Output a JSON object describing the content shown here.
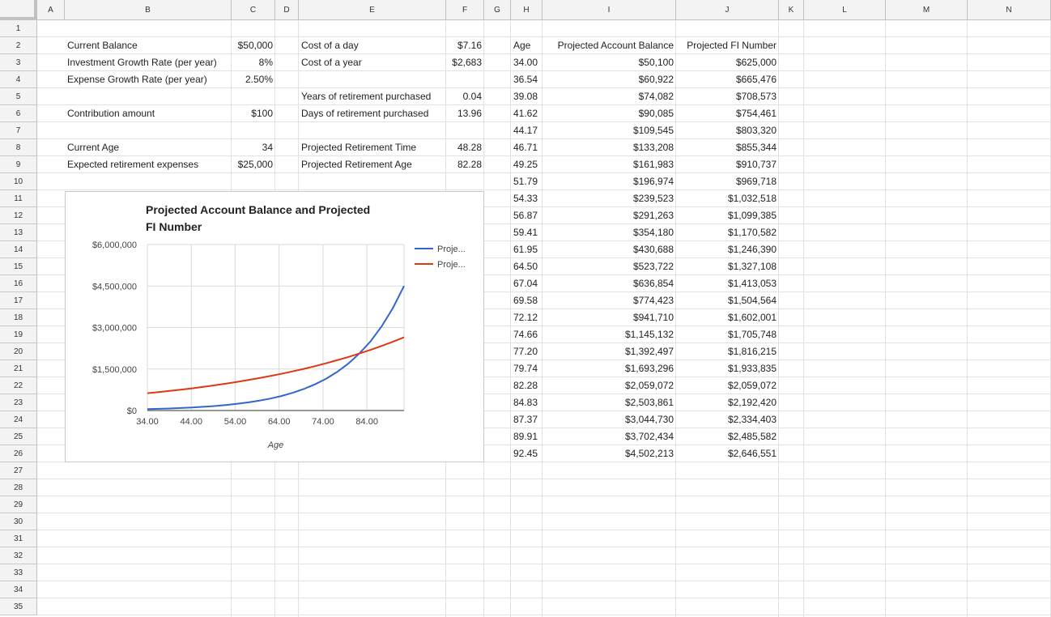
{
  "columns": [
    "A",
    "B",
    "C",
    "D",
    "E",
    "F",
    "G",
    "H",
    "I",
    "J",
    "K",
    "L",
    "M",
    "N"
  ],
  "rows": [
    "1",
    "2",
    "3",
    "4",
    "5",
    "6",
    "7",
    "8",
    "9",
    "10",
    "11",
    "12",
    "13",
    "14",
    "15",
    "16",
    "17",
    "18",
    "19",
    "20",
    "21",
    "22",
    "23",
    "24",
    "25",
    "26",
    "27",
    "28",
    "29",
    "30",
    "31",
    "32",
    "33",
    "34",
    "35"
  ],
  "inputs": [
    {
      "row": 2,
      "label": "Current Balance",
      "value": "$50,000"
    },
    {
      "row": 3,
      "label": "Investment Growth Rate (per year)",
      "value": "8%"
    },
    {
      "row": 4,
      "label": "Expense Growth Rate (per year)",
      "value": "2.50%"
    },
    {
      "row": 6,
      "label": "Contribution amount",
      "value": "$100"
    },
    {
      "row": 8,
      "label": "Current Age",
      "value": "34"
    },
    {
      "row": 9,
      "label": "Expected retirement expenses",
      "value": "$25,000"
    }
  ],
  "calcs": [
    {
      "row": 2,
      "label": "Cost of a day",
      "value": "$7.16"
    },
    {
      "row": 3,
      "label": "Cost of a year",
      "value": "$2,683"
    },
    {
      "row": 5,
      "label": "Years of retirement purchased",
      "value": "0.04"
    },
    {
      "row": 6,
      "label": "Days of retirement purchased",
      "value": "13.96"
    },
    {
      "row": 8,
      "label": "Projected Retirement Time",
      "value": "48.28"
    },
    {
      "row": 9,
      "label": "Projected Retirement Age",
      "value": "82.28"
    }
  ],
  "table": {
    "headers": [
      "Age",
      "Projected Account Balance",
      "Projected FI Number"
    ],
    "rows": [
      [
        "34.00",
        "$50,100",
        "$625,000"
      ],
      [
        "36.54",
        "$60,922",
        "$665,476"
      ],
      [
        "39.08",
        "$74,082",
        "$708,573"
      ],
      [
        "41.62",
        "$90,085",
        "$754,461"
      ],
      [
        "44.17",
        "$109,545",
        "$803,320"
      ],
      [
        "46.71",
        "$133,208",
        "$855,344"
      ],
      [
        "49.25",
        "$161,983",
        "$910,737"
      ],
      [
        "51.79",
        "$196,974",
        "$969,718"
      ],
      [
        "54.33",
        "$239,523",
        "$1,032,518"
      ],
      [
        "56.87",
        "$291,263",
        "$1,099,385"
      ],
      [
        "59.41",
        "$354,180",
        "$1,170,582"
      ],
      [
        "61.95",
        "$430,688",
        "$1,246,390"
      ],
      [
        "64.50",
        "$523,722",
        "$1,327,108"
      ],
      [
        "67.04",
        "$636,854",
        "$1,413,053"
      ],
      [
        "69.58",
        "$774,423",
        "$1,504,564"
      ],
      [
        "72.12",
        "$941,710",
        "$1,602,001"
      ],
      [
        "74.66",
        "$1,145,132",
        "$1,705,748"
      ],
      [
        "77.20",
        "$1,392,497",
        "$1,816,215"
      ],
      [
        "79.74",
        "$1,693,296",
        "$1,933,835"
      ],
      [
        "82.28",
        "$2,059,072",
        "$2,059,072"
      ],
      [
        "84.83",
        "$2,503,861",
        "$2,192,420"
      ],
      [
        "87.37",
        "$3,044,730",
        "$2,334,403"
      ],
      [
        "89.91",
        "$3,702,434",
        "$2,485,582"
      ],
      [
        "92.45",
        "$4,502,213",
        "$2,646,551"
      ]
    ]
  },
  "chart_data": {
    "type": "line",
    "title": "Projected Account Balance and Projected FI Number",
    "title_lines": [
      "Projected Account Balance and Projected",
      "FI Number"
    ],
    "xlabel": "Age",
    "ylabel": "",
    "x": [
      34.0,
      36.54,
      39.08,
      41.62,
      44.17,
      46.71,
      49.25,
      51.79,
      54.33,
      56.87,
      59.41,
      61.95,
      64.5,
      67.04,
      69.58,
      72.12,
      74.66,
      77.2,
      79.74,
      82.28,
      84.83,
      87.37,
      89.91,
      92.45
    ],
    "xlim": [
      34,
      92.45
    ],
    "xticks": [
      34,
      44,
      54,
      64,
      74,
      84
    ],
    "xtick_labels": [
      "34.00",
      "44.00",
      "54.00",
      "64.00",
      "74.00",
      "84.00"
    ],
    "ylim": [
      0,
      6000000
    ],
    "yticks": [
      0,
      1500000,
      3000000,
      4500000,
      6000000
    ],
    "ytick_labels": [
      "$0",
      "$1,500,000",
      "$3,000,000",
      "$4,500,000",
      "$6,000,000"
    ],
    "grid": true,
    "legend_position": "right",
    "legend_labels": [
      "Proje...",
      "Proje..."
    ],
    "series": [
      {
        "color": "#3366cc",
        "values": [
          50100,
          60922,
          74082,
          90085,
          109545,
          133208,
          161983,
          196974,
          239523,
          291263,
          354180,
          430688,
          523722,
          636854,
          774423,
          941710,
          1145132,
          1392497,
          1693296,
          2059072,
          2503861,
          3044730,
          3702434,
          4502213
        ]
      },
      {
        "color": "#dc3912",
        "values": [
          625000,
          665476,
          708573,
          754461,
          803320,
          855344,
          910737,
          969718,
          1032518,
          1099385,
          1170582,
          1246390,
          1327108,
          1413053,
          1504564,
          1602001,
          1705748,
          1816215,
          1933835,
          2059072,
          2192420,
          2334403,
          2485582,
          2646551
        ]
      }
    ]
  }
}
